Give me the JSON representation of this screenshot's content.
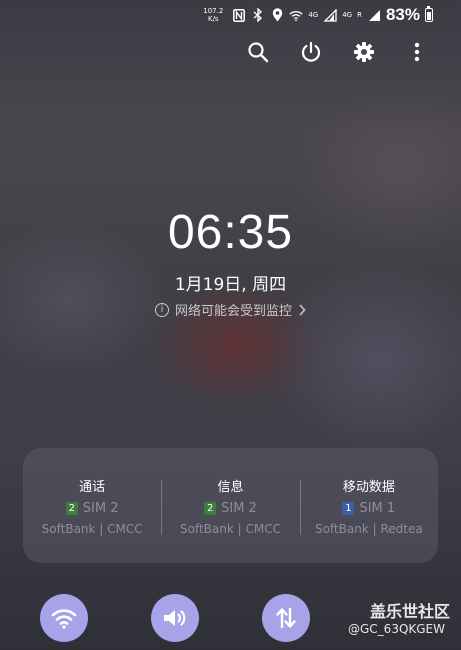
{
  "status_bar": {
    "net_speed_value": "107.2",
    "net_speed_unit": "K/s",
    "nfc_icon": "nfc-icon",
    "bluetooth_icon": "bluetooth-icon",
    "location_icon": "location-icon",
    "wifi_icon": "wifi-icon",
    "sim1_label": "4G",
    "sim2_label": "4G",
    "sim2_roaming": "R",
    "battery_percent": "83%",
    "battery_level": 0.83
  },
  "top_actions": {
    "search_icon": "search-icon",
    "power_icon": "power-icon",
    "settings_icon": "gear-icon",
    "more_icon": "more-vertical-icon"
  },
  "lockscreen": {
    "time": "06:35",
    "date": "1月19日, 周四",
    "monitor_note": "网络可能会受到监控",
    "monitor_icon": "info-icon",
    "chevron_icon": "chevron-right-icon"
  },
  "sim_panel": {
    "columns": [
      {
        "title": "通话",
        "badge": "2",
        "sim": "SIM 2",
        "carriers": "SoftBank | CMCC",
        "badge_color": "#3e7d3a"
      },
      {
        "title": "信息",
        "badge": "2",
        "sim": "SIM 2",
        "carriers": "SoftBank | CMCC",
        "badge_color": "#3e7d3a"
      },
      {
        "title": "移动数据",
        "badge": "1",
        "sim": "SIM 1",
        "carriers": "SoftBank | Redtea",
        "badge_color": "#3a5fa8"
      }
    ]
  },
  "quick_toggles": {
    "wifi": "wifi-icon",
    "sound": "volume-icon",
    "data": "data-transfer-icon",
    "accent_color": "#a7a3e8"
  },
  "watermark": {
    "site": "盖乐世社区",
    "user": "@GC_63QKGEW"
  }
}
